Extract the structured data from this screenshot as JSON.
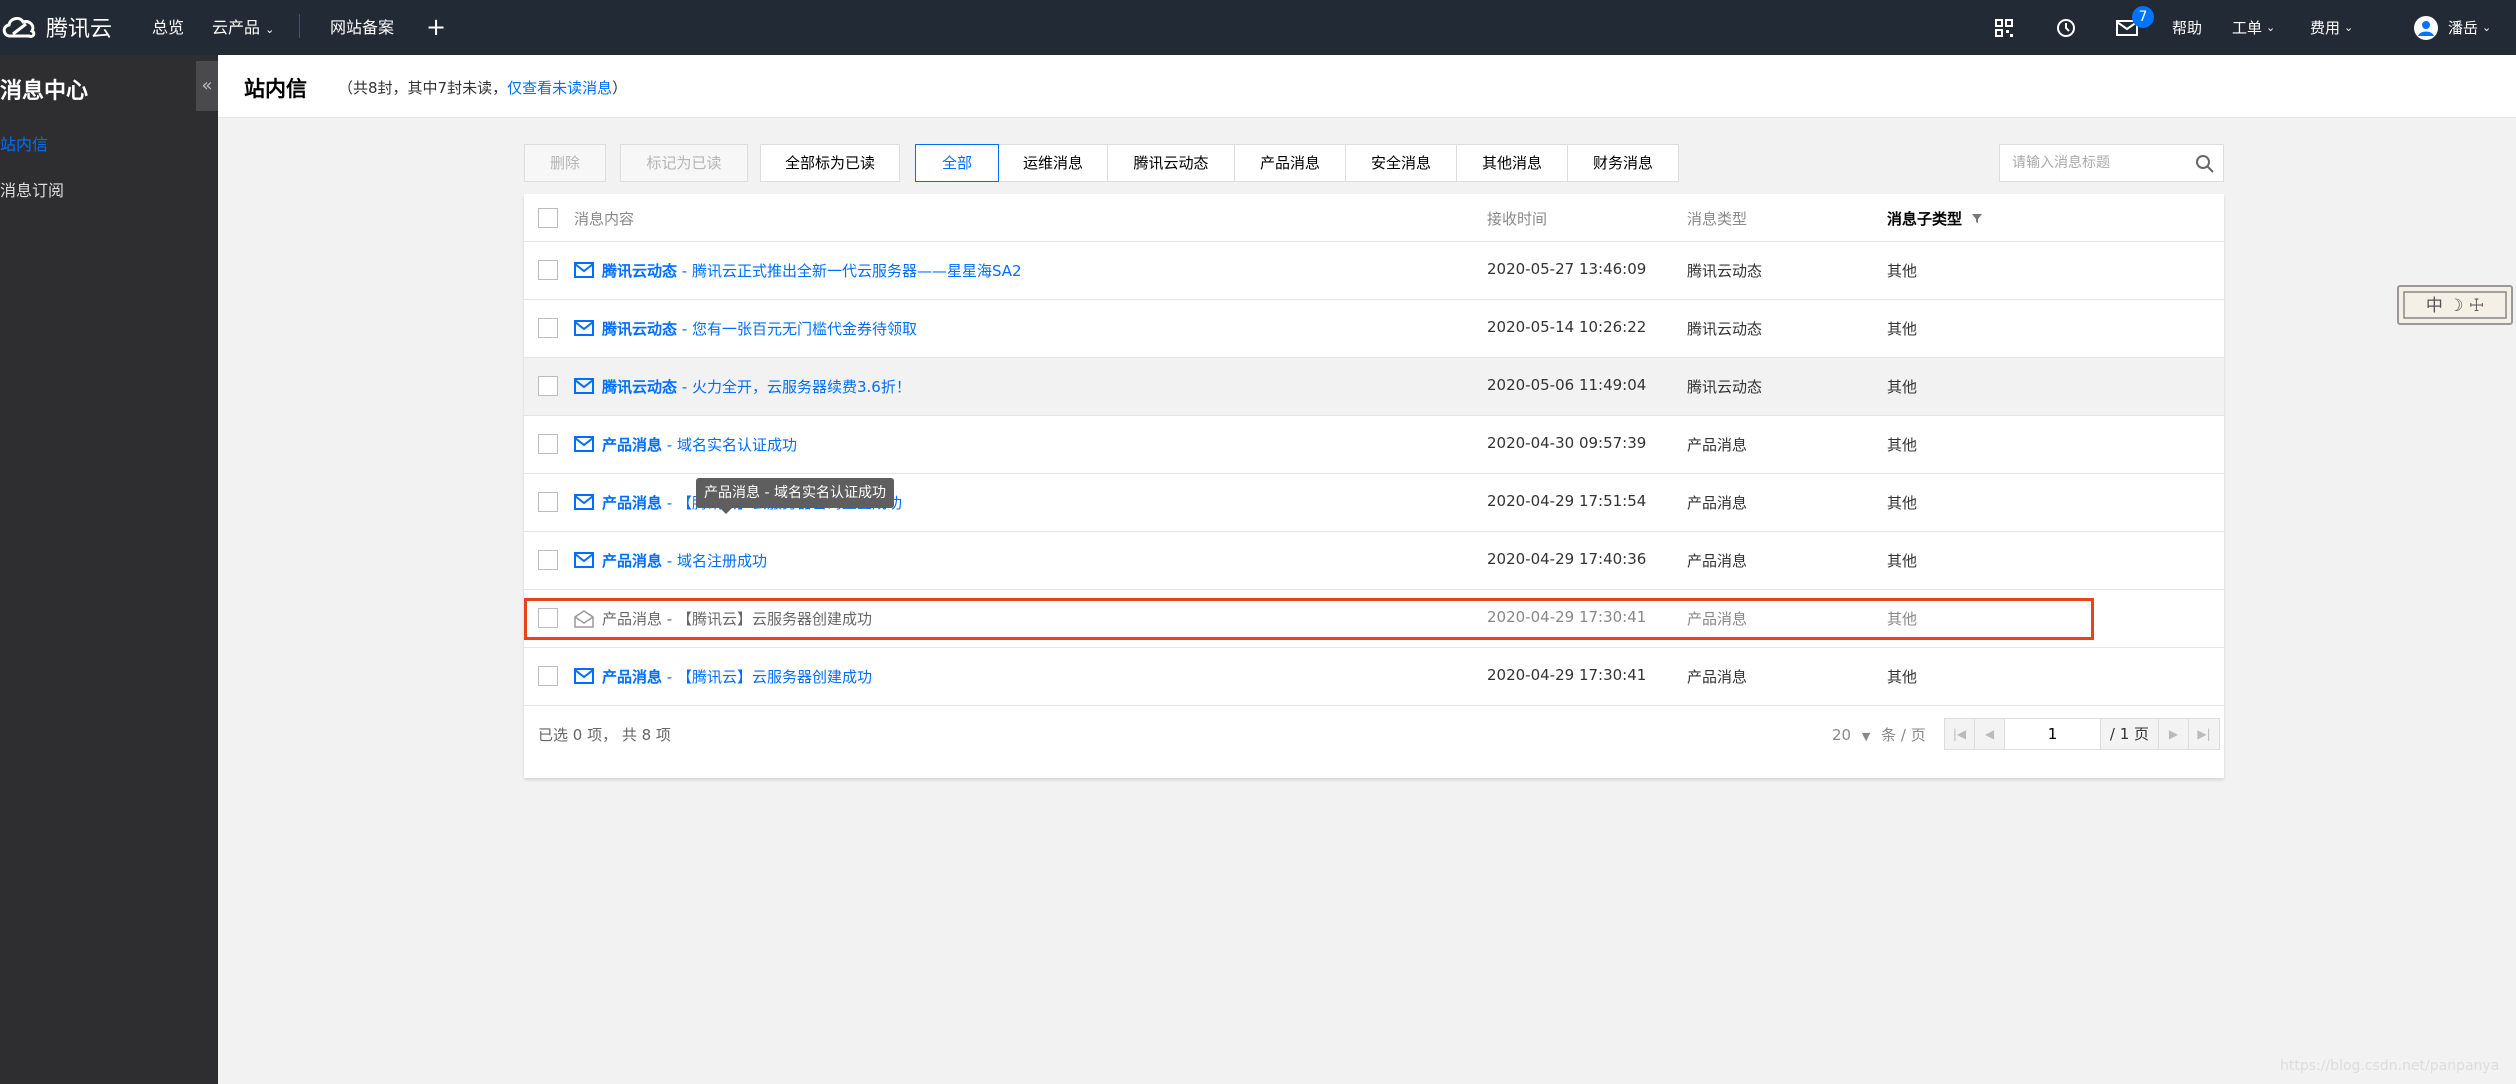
{
  "topbar": {
    "logo_text": "腾讯云",
    "nav": [
      "总览",
      "云产品",
      "网站备案"
    ],
    "badge_count": "7",
    "help": "帮助",
    "ticket": "工单",
    "billing": "费用",
    "user": "潘岳"
  },
  "sidebar": {
    "title": "消息中心",
    "collapse": "«",
    "items": [
      "站内信",
      "消息订阅"
    ],
    "active_color": "#006eff"
  },
  "header": {
    "title": "站内信",
    "sub_prefix": "（共8封，其中7封未读，",
    "sub_link": "仅查看未读消息",
    "sub_suffix": "）"
  },
  "toolbar": {
    "delete": "删除",
    "mark_read": "标记为已读",
    "mark_all_read": "全部标为已读"
  },
  "tabs": [
    "全部",
    "运维消息",
    "腾讯云动态",
    "产品消息",
    "安全消息",
    "其他消息",
    "财务消息"
  ],
  "search": {
    "placeholder": "请输入消息标题"
  },
  "table": {
    "headers": {
      "content": "消息内容",
      "time": "接收时间",
      "type": "消息类型",
      "subtype": "消息子类型"
    },
    "rows": [
      {
        "mtype": "腾讯云动态",
        "title": " - 腾讯云正式推出全新一代云服务器——星星海SA2",
        "time": "2020-05-27 13:46:09",
        "type": "腾讯云动态",
        "subtype": "其他"
      },
      {
        "mtype": "腾讯云动态",
        "title": " - 您有一张百元无门槛代金券待领取",
        "time": "2020-05-14 10:26:22",
        "type": "腾讯云动态",
        "subtype": "其他"
      },
      {
        "mtype": "腾讯云动态",
        "title": " - 火力全开，云服务器续费3.6折！",
        "time": "2020-05-06 11:49:04",
        "type": "腾讯云动态",
        "subtype": "其他"
      },
      {
        "mtype": "产品消息",
        "title": " - 域名实名认证成功",
        "time": "2020-04-30 09:57:39",
        "type": "产品消息",
        "subtype": "其他"
      },
      {
        "mtype": "产品消息",
        "title": " - 【腾讯云】云服务器密码重置成功",
        "time": "2020-04-29 17:51:54",
        "type": "产品消息",
        "subtype": "其他"
      },
      {
        "mtype": "产品消息",
        "title": " - 域名注册成功",
        "time": "2020-04-29 17:40:36",
        "type": "产品消息",
        "subtype": "其他"
      },
      {
        "mtype": "产品消息",
        "title": " - 【腾讯云】云服务器创建成功",
        "time": "2020-04-29 17:30:41",
        "type": "产品消息",
        "subtype": "其他"
      },
      {
        "mtype": "产品消息",
        "title": " - 【腾讯云】云服务器创建成功",
        "time": "2020-04-29 17:30:41",
        "type": "产品消息",
        "subtype": "其他"
      }
    ]
  },
  "footer": {
    "selected": "已选 0 项，  共 8 项",
    "page_size": "20",
    "page_size_unit": "条 / 页",
    "page": "1",
    "total_pages": "/ 1 页"
  },
  "tooltip": "产品消息 - 域名实名认证成功",
  "ime": "中 ☽ ☩",
  "watermark": "https://blog.csdn.net/panpanya"
}
